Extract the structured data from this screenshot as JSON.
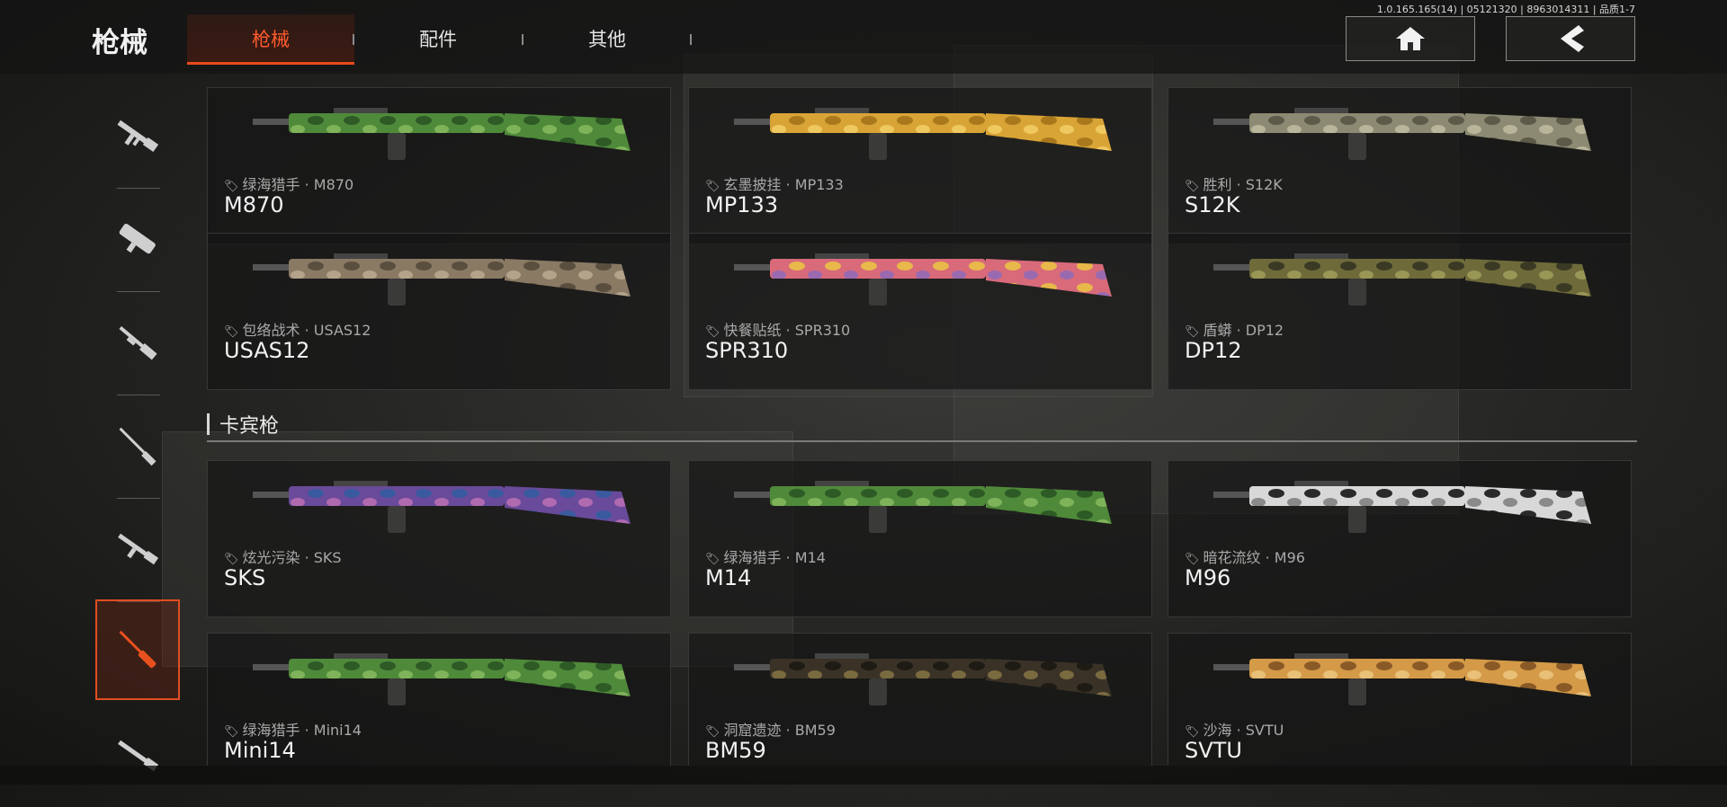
{
  "header": {
    "title": "枪械",
    "build_info": "1.0.165.165(14) | 05121320 | 8963014311 | 品质1-7",
    "tabs": [
      {
        "label": "枪械",
        "active": true
      },
      {
        "label": "配件",
        "active": false
      },
      {
        "label": "其他",
        "active": false
      }
    ],
    "home_icon": "home-icon",
    "back_icon": "back-chevron-icon"
  },
  "colors": {
    "accent": "#e84a1c",
    "accent_text": "#ff5a2c"
  },
  "sidebar": {
    "items": [
      {
        "icon": "assault-rifle-icon",
        "active": false
      },
      {
        "icon": "smg-icon",
        "active": false
      },
      {
        "icon": "shotgun-icon",
        "active": false
      },
      {
        "icon": "sniper-rifle-icon",
        "active": false
      },
      {
        "icon": "battle-rifle-icon",
        "active": false
      },
      {
        "icon": "marksman-rifle-icon",
        "active": true
      },
      {
        "icon": "rifle-icon",
        "active": false
      }
    ]
  },
  "section": {
    "title": "卡宾枪"
  },
  "guns": [
    {
      "name": "M870",
      "skin": "绿海猎手 · M870",
      "camo": [
        "#4f8a3a",
        "#2e5a26",
        "#7fb35a"
      ]
    },
    {
      "name": "MP133",
      "skin": "玄墨披挂 · MP133",
      "camo": [
        "#d9a436",
        "#a9781d",
        "#f0c860"
      ]
    },
    {
      "name": "S12K",
      "skin": "胜利 · S12K",
      "camo": [
        "#8c8a72",
        "#5c5a48",
        "#b8b59a"
      ]
    },
    {
      "name": "USAS12",
      "skin": "包络战术 · USAS12",
      "camo": [
        "#8a7a64",
        "#5a4e3e",
        "#b3a38a"
      ]
    },
    {
      "name": "SPR310",
      "skin": "快餐贴纸 · SPR310",
      "camo": [
        "#d86a7a",
        "#e8b84a",
        "#9a6ab0"
      ]
    },
    {
      "name": "DP12",
      "skin": "盾蟒 · DP12",
      "camo": [
        "#6e6a3a",
        "#3a3a24",
        "#9a9656"
      ]
    },
    {
      "name": "SKS",
      "skin": "炫光污染 · SKS",
      "camo": [
        "#6a4a9a",
        "#3a5aa0",
        "#b06ab0"
      ]
    },
    {
      "name": "M14",
      "skin": "绿海猎手 · M14",
      "camo": [
        "#4f8a3a",
        "#2e5a26",
        "#7fb35a"
      ]
    },
    {
      "name": "M96",
      "skin": "暗花流纹 · M96",
      "camo": [
        "#d8d8d8",
        "#2a2a2a",
        "#8a8a8a"
      ]
    },
    {
      "name": "Mini14",
      "skin": "绿海猎手 · Mini14",
      "camo": [
        "#4f8a3a",
        "#2e5a26",
        "#7fb35a"
      ]
    },
    {
      "name": "BM59",
      "skin": "洞窟遗迹 · BM59",
      "camo": [
        "#3a3226",
        "#1e1a14",
        "#7a6a40"
      ]
    },
    {
      "name": "SVTU",
      "skin": "沙海 · SVTU",
      "camo": [
        "#d49a48",
        "#8a5a26",
        "#e8c078"
      ]
    }
  ]
}
